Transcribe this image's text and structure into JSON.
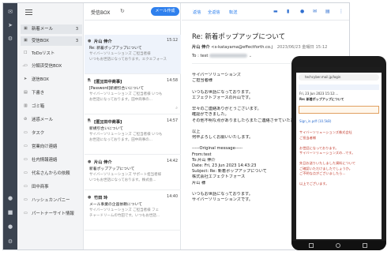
{
  "sidebar": {
    "items": [
      {
        "label": "新着メール",
        "count": "3",
        "icon": "inbox-icon"
      },
      {
        "label": "受信BOX",
        "count": "3",
        "icon": "inbox-icon"
      },
      {
        "label": "ToDoリスト",
        "count": "",
        "icon": "todo-icon"
      },
      {
        "label": "分類済受信BOX",
        "count": "",
        "icon": "folder-icon"
      },
      {
        "label": "送信BOX",
        "count": "",
        "icon": "send-icon"
      },
      {
        "label": "下書き",
        "count": "",
        "icon": "draft-icon"
      },
      {
        "label": "ゴミ箱",
        "count": "",
        "icon": "trash-icon"
      },
      {
        "label": "迷惑メール",
        "count": "",
        "icon": "spam-icon"
      },
      {
        "label": "タスク",
        "count": "",
        "icon": "folder-icon"
      },
      {
        "label": "営業向け連絡",
        "count": "",
        "icon": "folder-icon"
      },
      {
        "label": "社内情報連絡",
        "count": "",
        "icon": "folder-icon"
      },
      {
        "label": "代名さんからの依頼",
        "count": "",
        "icon": "folder-icon"
      },
      {
        "label": "田中商事",
        "count": "",
        "icon": "folder-icon"
      },
      {
        "label": "ハッシュカンパニー",
        "count": "",
        "icon": "folder-icon"
      },
      {
        "label": "パートナーサイト情報",
        "count": "",
        "icon": "folder-icon"
      }
    ]
  },
  "list": {
    "title": "受信BOX",
    "compose_label": "メール作成",
    "messages": [
      {
        "from": "片山 伸介",
        "time": "15:12",
        "subject": "Re: 新着ポップアップについて",
        "preview1": "サイバーソリューションズ ご担当者様",
        "preview2": "いつもお世話になっております。エクエフォース"
      },
      {
        "from": "[匿][田中商事]",
        "time": "14:58",
        "subject": "[Password]新規引合いについて",
        "preview1": "サイバーソリューションズ ご担当者様 いつも",
        "preview2": "お世話になっております。田中商事の..."
      },
      {
        "from": "[匿][田中商事]",
        "time": "14:57",
        "subject": "新規引合いについて",
        "preview1": "サイバーソリューションズ ご担当者様 いつも",
        "preview2": "お世話になっております。田中商事の..."
      },
      {
        "from": "片山 伸介",
        "time": "14:42",
        "subject": "新着ポップアップについて",
        "preview1": "サイバーソリューションズ サポート担当者様",
        "preview2": "いつもお世話になっております。株式会..."
      },
      {
        "from": "竹田 玲",
        "time": "14:40",
        "subject": "メール事業の企画依頼について",
        "preview1": "サイバーソリューションズ ご担当者様 フェ",
        "preview2": "チャードリームの竹田です。いつもお世話..."
      }
    ]
  },
  "toolbar": {
    "reply": "返信",
    "reply_all": "全返信",
    "forward": "転送"
  },
  "view": {
    "subject": "Re: 新着ポップアップについて",
    "from_name": "片山 伸介",
    "from_email": "<s-katayama@effectforth.co.j",
    "date": "2023/06/23 金曜日 15:12",
    "to_label": "To : test",
    "body": [
      "サイバーソリューションズ",
      "ご担当者様",
      "",
      "いつもお世話になっております。",
      "エフェクトフォースの片山です。",
      "",
      "早々のご連絡ありがとうございます。",
      "確認ができました。",
      "その他不明な点がありましたらまたご連絡させていただきます。",
      "",
      "以上",
      "何卒よろしくお願いいたします。",
      "",
      "-----Original message-----",
      "From:test",
      "To:片山 伸介",
      "Date: Fri, 23 Jun 2023 14:43:23",
      "Subject: Re: 新着ポップアップについて",
      "株式会社エフェクトフォース",
      "片山 様",
      "",
      "いつもお世話になっております。",
      "サイバーソリューションズです。"
    ]
  },
  "phone": {
    "url": "techcyber.mail.jp/login",
    "date": "Fri, 23 Jun 2023 15:12:...",
    "subject": "Re: 新着ポップアップについて",
    "attach": "Sign_in.pdf (10.5kB)",
    "body": [
      "サイバーソリューションズ株式会社",
      "ご担当者様",
      "",
      "お世話になっております。",
      "サイバーソリューションズの...です。",
      "",
      "先日お送りいたしました資料について",
      "ご確認いただけましたでしょうか。",
      "ご不明な点がございましたら...",
      "",
      "以上でございます。"
    ]
  }
}
